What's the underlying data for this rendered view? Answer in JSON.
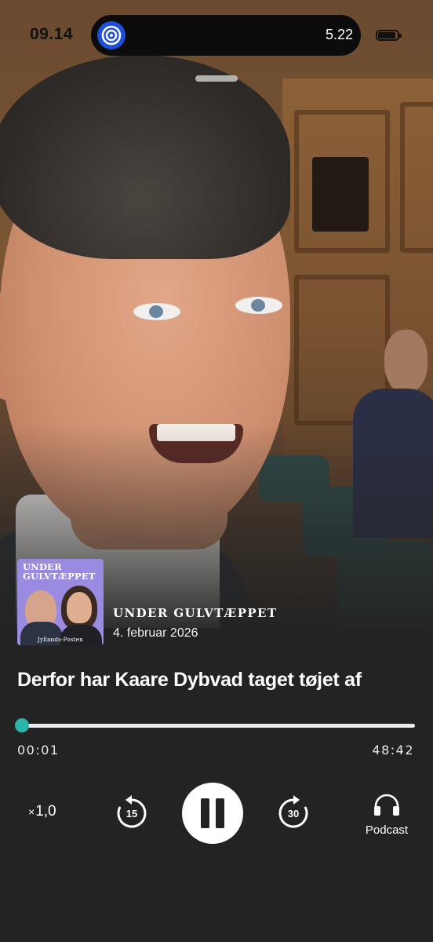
{
  "status_bar": {
    "time": "09.14",
    "live_activity_time": "5.22"
  },
  "episode": {
    "show_name": "UNDER GULVTÆPPET",
    "date": "4. februar 2026",
    "title": "Derfor har Kaare Dybvad taget tøjet af",
    "cover": {
      "title_line1": "UNDER",
      "title_line2": "GULVTÆPPET",
      "publisher": "Jyllands-Posten"
    }
  },
  "player": {
    "elapsed": "00:01",
    "total": "48:42",
    "progress": 0.0003,
    "speed_prefix": "×",
    "speed_value": "1,0",
    "skip_back_seconds": "15",
    "skip_forward_seconds": "30",
    "podcast_label": "Podcast",
    "state": "playing"
  },
  "colors": {
    "background": "#232323",
    "accent": "#2bb5a8",
    "island_icon": "#1d4fd8"
  },
  "icons": {
    "skip_back": "rotate-ccw-15-icon",
    "skip_forward": "rotate-cw-30-icon",
    "pause": "pause-icon",
    "podcast": "headphones-icon",
    "live_activity": "target-icon"
  }
}
